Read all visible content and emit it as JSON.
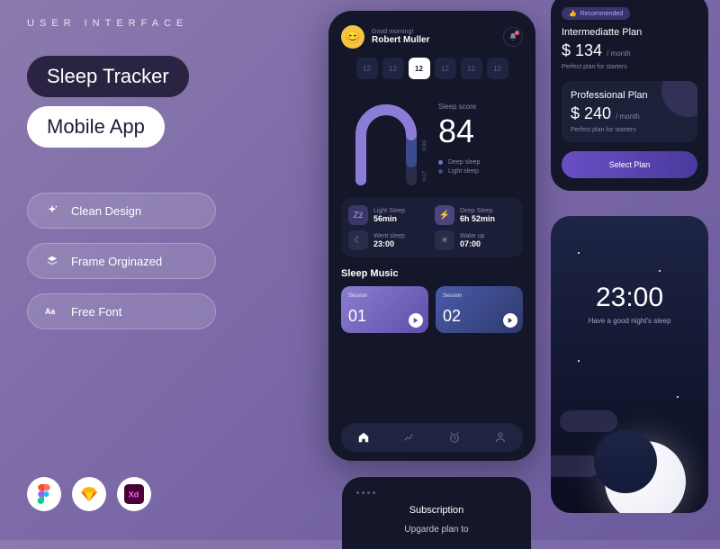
{
  "left": {
    "kicker": "USER INTERFACE",
    "title1": "Sleep Tracker",
    "title2": "Mobile App",
    "features": [
      "Clean Design",
      "Frame Orginazed",
      "Free Font"
    ],
    "tools": [
      "figma",
      "sketch",
      "xd"
    ]
  },
  "dashboard": {
    "greeting": "Good morning!",
    "user_name": "Robert Muller",
    "dates": [
      "12",
      "12",
      "12",
      "12",
      "12",
      "12"
    ],
    "active_date_index": 2,
    "score_label": "Sleep score",
    "score_value": "84",
    "legend": [
      {
        "label": "Deep sleep",
        "color": "#7c6bd6"
      },
      {
        "label": "Light sleep",
        "color": "#3d4b8e"
      }
    ],
    "arc_labels": {
      "deep_pct": "86%",
      "light_pct": "27%"
    },
    "stats": [
      {
        "label": "Light Sleep",
        "value": "56min",
        "icon": "zz"
      },
      {
        "label": "Deep Sleep",
        "value": "6h 52min",
        "icon": "bolt"
      },
      {
        "label": "Went sleep",
        "value": "23:00",
        "icon": "moon"
      },
      {
        "label": "Wake up",
        "value": "07:00",
        "icon": "sun"
      }
    ],
    "music_header": "Sleep Music",
    "sessions": [
      {
        "label": "Session",
        "num": "01"
      },
      {
        "label": "Session",
        "num": "02"
      }
    ],
    "nav": [
      "home",
      "chart",
      "alarm",
      "profile"
    ]
  },
  "pricing": {
    "recommended": "Recommended",
    "plans": [
      {
        "name": "Intermediatte Plan",
        "price": "$ 134",
        "period": "/ month",
        "desc": "Perfect plan for starters"
      },
      {
        "name": "Professional Plan",
        "price": "$ 240",
        "period": "/ month",
        "desc": "Perfect plan for starters"
      }
    ],
    "select": "Select Plan"
  },
  "night": {
    "time": "23:00",
    "sub": "Have a good night's sleep"
  },
  "subscription": {
    "header": "Subscription",
    "text": "Upgarde plan to"
  }
}
